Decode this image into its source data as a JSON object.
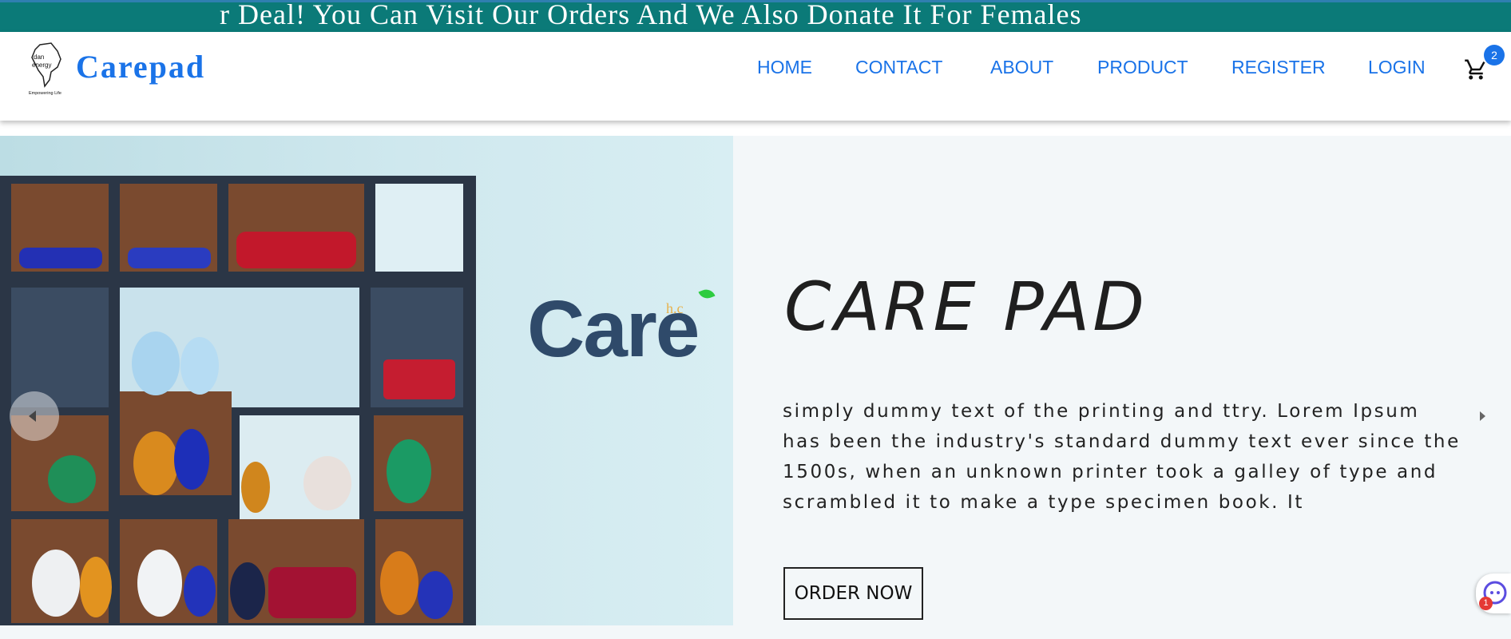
{
  "banner": {
    "text": "r Deal! You Can Visit Our Orders And We Also Donate It For Females"
  },
  "header": {
    "brand": "Carepad",
    "logo": {
      "text_top": "dan",
      "text_mid": "energy",
      "tagline": "Empowering Life"
    },
    "nav": [
      "HOME",
      "CONTACT",
      "ABOUT",
      "PRODUCT",
      "REGISTER",
      "LOGIN"
    ],
    "cart": {
      "icon": "cart-icon",
      "count": "2"
    }
  },
  "hero": {
    "image_logo": {
      "text": "Care",
      "suffix": "h.c"
    },
    "title": "CARE PAD",
    "text": "simply dummy text of the printing and ttry. Lorem Ipsum has been the industry's standard dummy text ever since the 1500s, when an unknown printer took a galley of type and scrambled it to make a type specimen book. It",
    "button": "ORDER NOW"
  },
  "chat": {
    "icon": "chat-icon",
    "badge": "1"
  },
  "colors": {
    "banner": "#0b7a78",
    "accent": "#1a73e8",
    "hero_bg": "#f3f7f9"
  }
}
